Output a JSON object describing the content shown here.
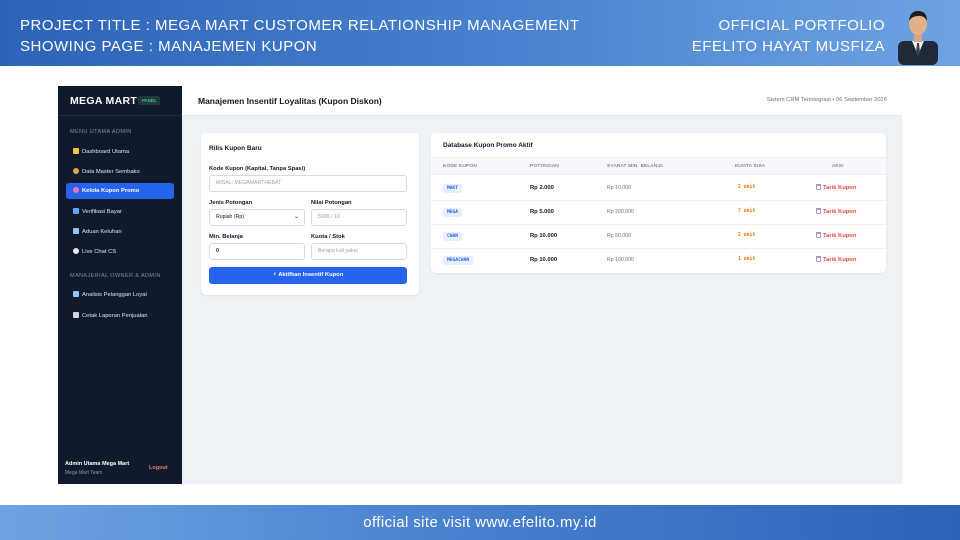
{
  "banner": {
    "project_line": "PROJECT TITLE  : MEGA MART CUSTOMER RELATIONSHIP MANAGEMENT",
    "page_line": "SHOWING PAGE : MANAJEMEN KUPON",
    "portfolio_line": "OFFICIAL PORTFOLIO",
    "author_line": "EFELITO HAYAT MUSFIZA",
    "footer": "official site visit www.efelito.my.id"
  },
  "sidebar": {
    "brand": "MEGA MART",
    "badge": "PANEL",
    "section1": "MENU UTAMA ADMIN",
    "section2": "MANAJERIAL OWNER & ADMIN",
    "items": [
      {
        "label": "Dashboard Utama",
        "icon": "chart-icon",
        "color": "#f5c542"
      },
      {
        "label": "Data Master Sembako",
        "icon": "box-icon",
        "color": "#e0a458"
      },
      {
        "label": "Kelola Kupon Promo",
        "icon": "ticket-icon",
        "color": "#f472b6"
      },
      {
        "label": "Verifikasi Bayar",
        "icon": "card-icon",
        "color": "#60a5fa"
      },
      {
        "label": "Aduan Keluhan",
        "icon": "inbox-icon",
        "color": "#93c5fd"
      },
      {
        "label": "Live Chat CS",
        "icon": "chat-icon",
        "color": "#e5e7eb"
      },
      {
        "label": "Analisis Pelanggan Loyal",
        "icon": "chart-icon",
        "color": "#93c5fd"
      },
      {
        "label": "Cetak Laporan Penjualan",
        "icon": "print-icon",
        "color": "#d1d5db"
      }
    ],
    "user_name": "Admin Utama Mega Mart",
    "user_team": "Mega Mart Team",
    "logout": "Logout"
  },
  "topbar": {
    "title": "Manajemen Insentif Loyalitas (Kupon Diskon)",
    "info": "Sistem CRM Terintegrasi • 06 September 2026"
  },
  "form": {
    "title": "Rilis Kupon Baru",
    "code_label": "Kode Kupon (Kapital, Tanpa Spasi)",
    "code_placeholder": "MISAL: MEGAMARTHEBAT",
    "type_label": "Jenis Potongan",
    "type_value": "Rupiah (Rp)",
    "amount_label": "Nilai Potongan",
    "amount_placeholder": "5000 / 10",
    "min_label": "Min. Belanja",
    "min_value": "0",
    "quota_label": "Kuota / Stok",
    "quota_placeholder": "Berapa kali pakai",
    "submit": "⚡ Aktifkan Insentif Kupon"
  },
  "table": {
    "title": "Database Kupon Promo Aktif",
    "headers": [
      "KODE KUPON",
      "POTONGAN",
      "SYARAT MIN. BELANJA",
      "KUOTA SISA",
      "AKSI"
    ],
    "rows": [
      {
        "code": "MAKT",
        "cut": "Rp 2.000",
        "min": "Rp 10.000",
        "quota": "2 unit",
        "action": "Tarik Kupon"
      },
      {
        "code": "MEGA",
        "cut": "Rp 5.000",
        "min": "Rp 200.000",
        "quota": "7 unit",
        "action": "Tarik Kupon"
      },
      {
        "code": "CHAN",
        "cut": "Rp 10.000",
        "min": "Rp 50.000",
        "quota": "2 unit",
        "action": "Tarik Kupon"
      },
      {
        "code": "MEGACHAN",
        "cut": "Rp 10.000",
        "min": "Rp 100.000",
        "quota": "1 unit",
        "action": "Tarik Kupon"
      }
    ]
  }
}
